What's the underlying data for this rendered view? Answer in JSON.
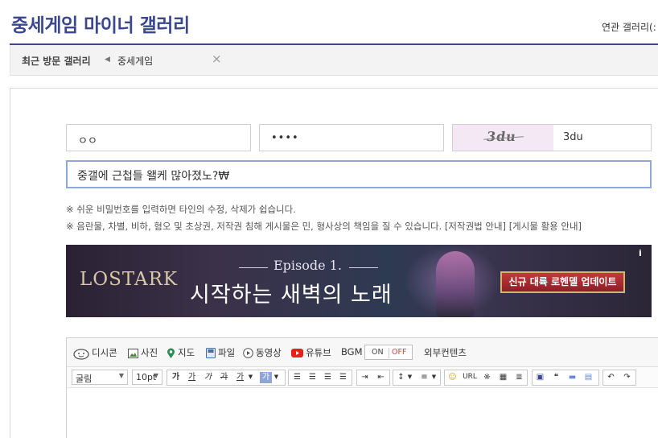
{
  "header": {
    "title": "중세게임 마이너 갤러리",
    "related": "연관 갤러리(:"
  },
  "recent": {
    "label": "최근 방문 갤러리",
    "items": [
      "중세게임"
    ],
    "close": "×"
  },
  "form": {
    "name_value": "ㅇㅇ",
    "password_value": "••••",
    "captcha_image_text": "3du",
    "captcha_value": "3du",
    "subject_value": "중갤에 근첩들 왤케 많아졌노?₩"
  },
  "notices": [
    "※ 쉬운 비밀번호를 입력하면 타인의 수정, 삭제가 쉽습니다.",
    "※ 음란물, 차별, 비하, 혐오 및 초상권, 저작권 침해 게시물은 민, 형사상의 책임을 질 수 있습니다. [저작권법 안내] [게시물 활용 안내]"
  ],
  "banner": {
    "logo": "LOSTARK",
    "episode": "Episode 1.",
    "headline": "시작하는 새벽의 노래",
    "cta": "신규 대륙 로헨델 업데이트",
    "info": "i"
  },
  "editor": {
    "toolbar1": [
      {
        "label": "디시콘",
        "icon": "dccon-icon"
      },
      {
        "label": "사진",
        "icon": "image-icon"
      },
      {
        "label": "지도",
        "icon": "map-pin-icon"
      },
      {
        "label": "파일",
        "icon": "file-icon"
      },
      {
        "label": "동영상",
        "icon": "video-icon"
      },
      {
        "label": "유튜브",
        "icon": "youtube-icon"
      }
    ],
    "bgm_label": "BGM",
    "bgm_on": "ON",
    "bgm_off": "OFF",
    "external": "외부컨텐츠",
    "font_family": "굴림",
    "font_size": "10pt",
    "format_buttons": [
      "가",
      "가",
      "가",
      "가",
      "가",
      "가"
    ],
    "url_label": "URL"
  },
  "colors": {
    "title": "#3b4890",
    "youtube": "#e62117",
    "map": "#2e8b57",
    "off": "#e03a3a"
  }
}
